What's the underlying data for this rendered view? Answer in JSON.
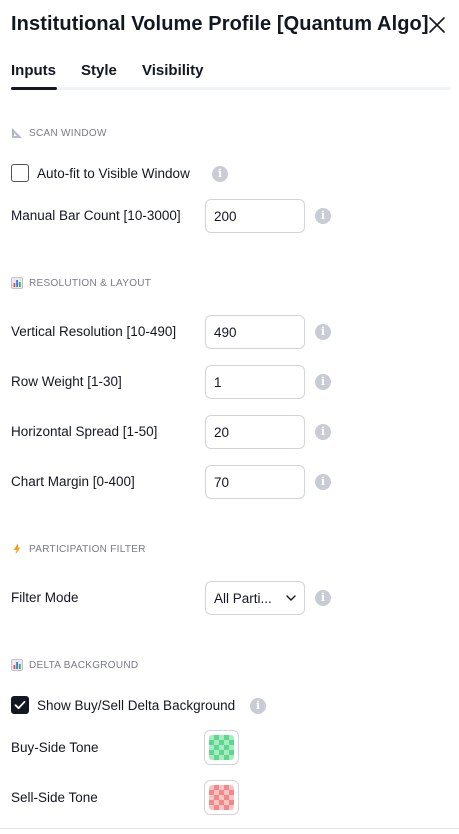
{
  "dialog": {
    "title": "Institutional Volume Profile [Quantum Algo]"
  },
  "tabs": [
    {
      "label": "Inputs",
      "active": true
    },
    {
      "label": "Style",
      "active": false
    },
    {
      "label": "Visibility",
      "active": false
    }
  ],
  "sections": {
    "scan_window": {
      "title": "SCAN WINDOW",
      "icon": "triangle-ruler-icon",
      "auto_fit": {
        "label": "Auto-fit to Visible Window",
        "checked": false
      },
      "manual_bar_count": {
        "label": "Manual Bar Count [10-3000]",
        "value": "200"
      }
    },
    "resolution_layout": {
      "title": "RESOLUTION & LAYOUT",
      "icon": "bar-chart-icon",
      "vertical_resolution": {
        "label": "Vertical Resolution [10-490]",
        "value": "490"
      },
      "row_weight": {
        "label": "Row Weight [1-30]",
        "value": "1"
      },
      "horizontal_spread": {
        "label": "Horizontal Spread [1-50]",
        "value": "20"
      },
      "chart_margin": {
        "label": "Chart Margin [0-400]",
        "value": "70"
      }
    },
    "participation_filter": {
      "title": "PARTICIPATION FILTER",
      "icon": "lightning-icon",
      "filter_mode": {
        "label": "Filter Mode",
        "value": "All Parti..."
      }
    },
    "delta_background": {
      "title": "DELTA BACKGROUND",
      "icon": "bar-chart-icon",
      "show_delta": {
        "label": "Show Buy/Sell Delta Background",
        "checked": true
      },
      "buy_side_tone": {
        "label": "Buy-Side Tone",
        "color": "#26a69a"
      },
      "sell_side_tone": {
        "label": "Sell-Side Tone",
        "color": "#ef5350"
      }
    }
  },
  "colors": {
    "text": "#131722",
    "muted": "#787b86",
    "border": "#d1d4dc",
    "buy_swatch_a": "#5fd68e",
    "buy_swatch_b": "#a8ebc2",
    "sell_swatch_a": "#f08a8a",
    "sell_swatch_b": "#f7c4c4"
  }
}
